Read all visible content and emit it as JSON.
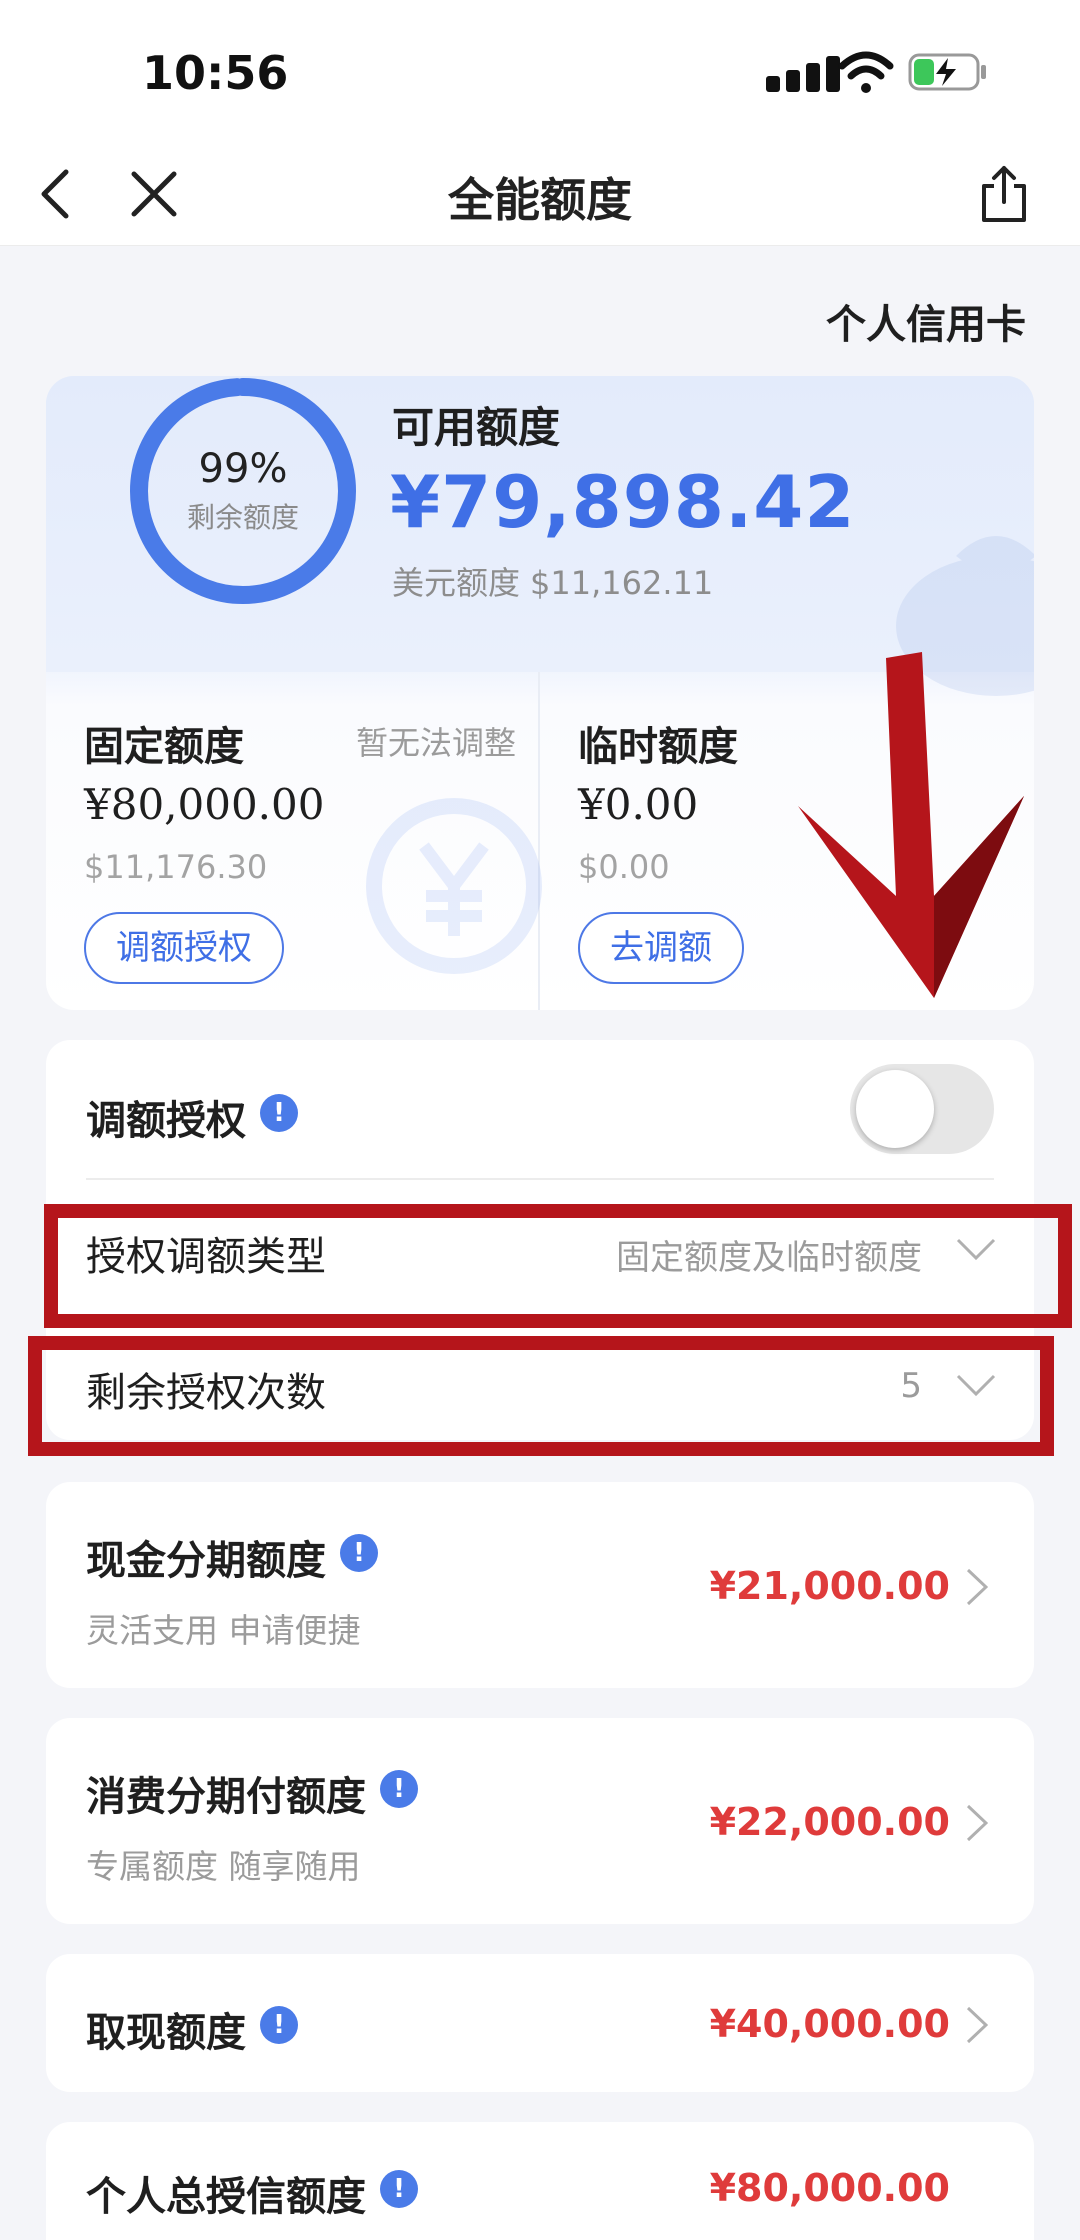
{
  "status_bar": {
    "time": "10:56"
  },
  "nav": {
    "title": "全能额度"
  },
  "card_type": "个人信用卡",
  "summary": {
    "ring_percent": "99%",
    "ring_percent_value": 0.99,
    "ring_label": "剩余额度",
    "available_label": "可用额度",
    "available_amount": "¥79,898.42",
    "usd_label": "美元额度",
    "usd_amount": "$11,162.11",
    "accent_color": "#4a7be8"
  },
  "fixed": {
    "title": "固定额度",
    "note": "暂无法调整",
    "amount": "¥80,000.00",
    "usd": "$11,176.30",
    "button": "调额授权"
  },
  "temporary": {
    "title": "临时额度",
    "amount": "¥0.00",
    "usd": "$0.00",
    "button": "去调额"
  },
  "auth": {
    "title": "调额授权",
    "toggle_on": false,
    "type_label": "授权调额类型",
    "type_value": "固定额度及临时额度",
    "remaining_label": "剩余授权次数",
    "remaining_value": "5"
  },
  "amounts": [
    {
      "title": "现金分期额度",
      "subtitle": "灵活支用 申请便捷",
      "value": "¥21,000.00"
    },
    {
      "title": "消费分期付额度",
      "subtitle": "专属额度 随享随用",
      "value": "¥22,000.00"
    },
    {
      "title": "取现额度",
      "subtitle": "",
      "value": "¥40,000.00"
    },
    {
      "title": "个人总授信额度",
      "subtitle": "",
      "value": "¥80,000.00"
    }
  ],
  "colors": {
    "amount_red": "#df3b3b",
    "highlight_red": "#b5151b",
    "link_blue": "#3f6fe6"
  }
}
